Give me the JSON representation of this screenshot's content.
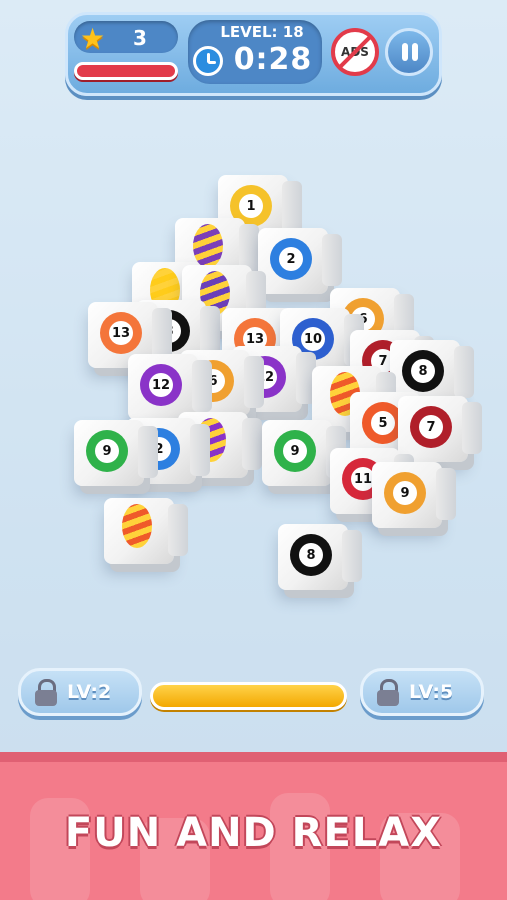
{
  "hud": {
    "stars": "3",
    "level_label": "LEVEL: 18",
    "timer": "0:28",
    "noads_label": "ADS"
  },
  "progress": {
    "left_level": "LV:2",
    "right_level": "LV:5",
    "fill_fraction": 1.0
  },
  "tiles": [
    {
      "label": "1",
      "color": "#f5c22a"
    },
    {
      "label": "",
      "color": "#7b3fb8"
    },
    {
      "label": "2",
      "color": "#2d7fe0"
    },
    {
      "label": "",
      "color": "#ffcc1a"
    },
    {
      "label": "13",
      "color": "#f4753a"
    },
    {
      "label": "8",
      "color": "#111111"
    },
    {
      "label": "13",
      "color": "#f4753a"
    },
    {
      "label": "10",
      "color": "#2d5fcf"
    },
    {
      "label": "6",
      "color": "#f0a030"
    },
    {
      "label": "",
      "color": "#6a3fb8"
    },
    {
      "label": "12",
      "color": "#8a33c8"
    },
    {
      "label": "6",
      "color": "#f0a030"
    },
    {
      "label": "12",
      "color": "#8a33c8"
    },
    {
      "label": "7",
      "color": "#b01f2a"
    },
    {
      "label": "8",
      "color": "#111111"
    },
    {
      "label": "",
      "color": "#ef5a2a"
    },
    {
      "label": "5",
      "color": "#ef5a2a"
    },
    {
      "label": "7",
      "color": "#b01f2a"
    },
    {
      "label": "9",
      "color": "#2fb24a"
    },
    {
      "label": "2",
      "color": "#2d7fe0"
    },
    {
      "label": "",
      "color": "#8a33c8"
    },
    {
      "label": "9",
      "color": "#2fb24a"
    },
    {
      "label": "11",
      "color": "#d6283a"
    },
    {
      "label": "9",
      "color": "#f0a030"
    },
    {
      "label": "",
      "color": "#ef5a2a"
    },
    {
      "label": "8",
      "color": "#111111"
    }
  ],
  "banner": {
    "tagline": "FUN AND RELAX"
  }
}
